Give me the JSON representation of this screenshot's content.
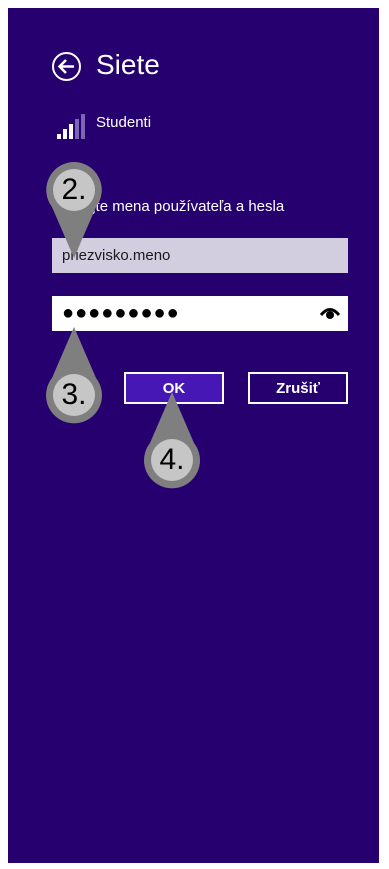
{
  "header": {
    "title": "Siete",
    "back_icon": "back-arrow-icon"
  },
  "network": {
    "name": "Studenti",
    "signal_icon": "wifi-signal-icon"
  },
  "form": {
    "prompt": "Zadajte mena používateľa a hesla",
    "username_value": "priezvisko.meno",
    "password_value": "●●●●●●●●●",
    "reveal_icon": "eye-icon"
  },
  "buttons": {
    "ok_label": "OK",
    "cancel_label": "Zrušiť"
  },
  "annotations": {
    "step2": "2.",
    "step3": "3.",
    "step4": "4."
  },
  "colors": {
    "background": "#25006e",
    "ok_button": "#4617b4",
    "username_field": "#d3cde0",
    "marker_outer": "#7f7f7f",
    "marker_inner": "#c6c6c6"
  }
}
